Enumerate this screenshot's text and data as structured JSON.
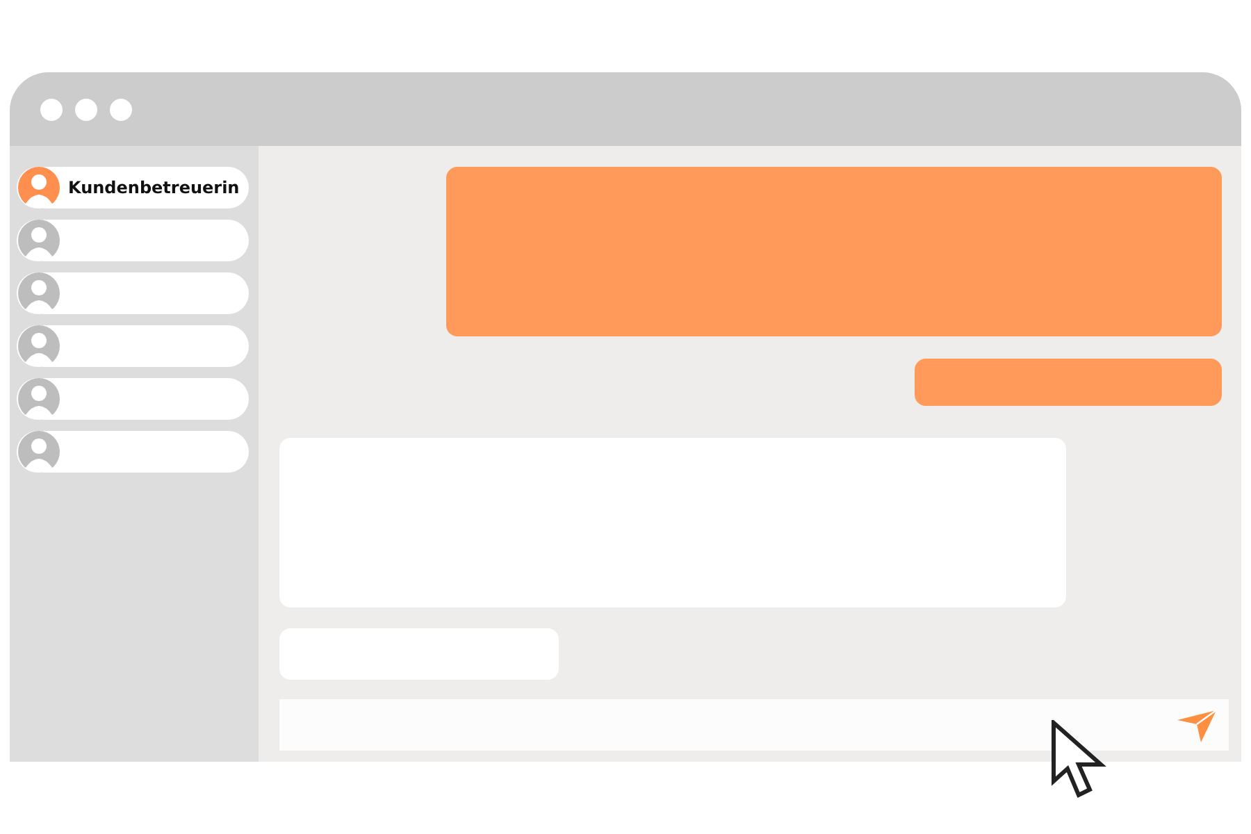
{
  "contacts": [
    {
      "name": "Kundenbetreuerin",
      "selected": true
    },
    {
      "selected": false
    },
    {
      "selected": false
    },
    {
      "selected": false
    },
    {
      "selected": false
    },
    {
      "selected": false
    }
  ],
  "outgoing_messages": [
    {
      "kind": "long"
    },
    {
      "kind": "short"
    }
  ],
  "incoming_messages": [
    {
      "kind": "long"
    },
    {
      "kind": "short"
    }
  ]
}
